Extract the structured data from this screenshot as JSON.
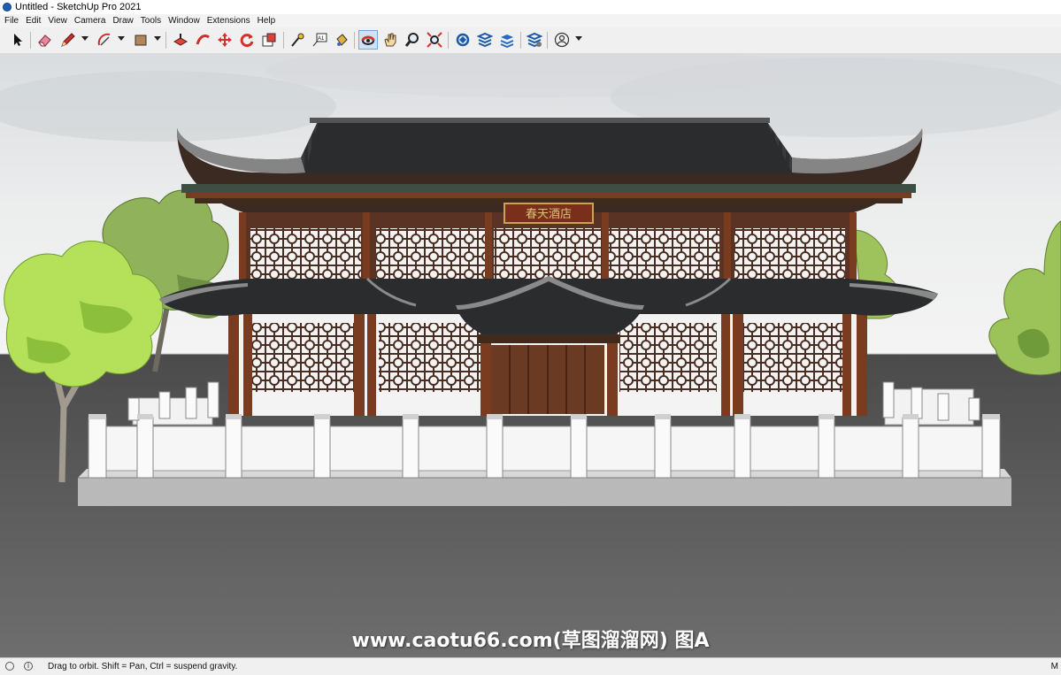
{
  "window": {
    "title": "Untitled - SketchUp Pro 2021"
  },
  "menu": [
    "File",
    "Edit",
    "View",
    "Camera",
    "Draw",
    "Tools",
    "Window",
    "Extensions",
    "Help"
  ],
  "toolbar": {
    "tools": [
      {
        "name": "select-tool",
        "icon": "arrow-cursor-icon"
      },
      {
        "name": "eraser-tool",
        "icon": "eraser-icon"
      },
      {
        "name": "line-tool",
        "icon": "pencil-icon"
      },
      {
        "name": "arc-tool",
        "icon": "arc-icon"
      },
      {
        "name": "rectangle-tool",
        "icon": "rectangle-icon"
      },
      {
        "name": "push-pull-tool",
        "icon": "push-pull-icon"
      },
      {
        "name": "follow-me-tool",
        "icon": "follow-me-icon"
      },
      {
        "name": "move-tool",
        "icon": "move-icon"
      },
      {
        "name": "rotate-tool",
        "icon": "rotate-icon"
      },
      {
        "name": "scale-tool",
        "icon": "scale-icon"
      },
      {
        "name": "tape-measure-tool",
        "icon": "tape-measure-icon"
      },
      {
        "name": "text-tool",
        "icon": "text-icon"
      },
      {
        "name": "paint-bucket-tool",
        "icon": "paint-bucket-icon"
      },
      {
        "name": "orbit-tool",
        "icon": "orbit-icon"
      },
      {
        "name": "pan-tool",
        "icon": "hand-icon"
      },
      {
        "name": "zoom-tool",
        "icon": "magnifier-icon"
      },
      {
        "name": "zoom-extents-tool",
        "icon": "zoom-extents-icon"
      },
      {
        "name": "3d-warehouse",
        "icon": "warehouse-icon"
      },
      {
        "name": "extension-warehouse",
        "icon": "extension-warehouse-icon"
      },
      {
        "name": "layout",
        "icon": "layout-icon"
      },
      {
        "name": "extension-manager",
        "icon": "extension-manager-icon"
      },
      {
        "name": "account",
        "icon": "user-icon"
      }
    ],
    "text_tool_glyph": "A1"
  },
  "viewport": {
    "sign_text": "春天酒店",
    "colors": {
      "sky_top": "#e6e8ea",
      "ground": "#5e5e5e",
      "roof": "#2b2c2e",
      "wood": "#6b3a22",
      "lattice": "#4a2e22",
      "wall": "#f4f4f4"
    }
  },
  "watermark": "www.caotu66.com(草图溜溜网) 图A",
  "statusbar": {
    "message": "Drag to orbit. Shift = Pan, Ctrl = suspend gravity.",
    "right_label": "M"
  }
}
